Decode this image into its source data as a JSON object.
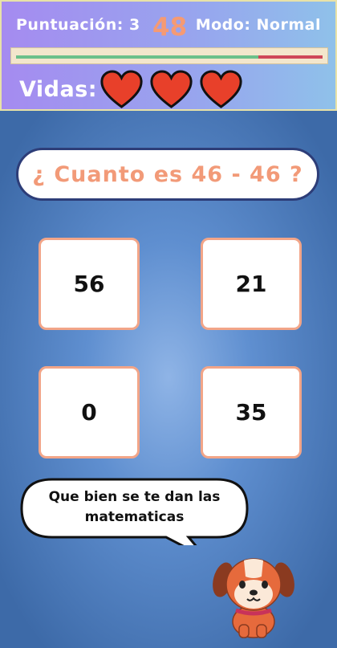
{
  "hud": {
    "score_text": "Puntuación: 3",
    "timer": "48",
    "mode_text": "Modo: Normal",
    "time_remaining_fraction": 0.79,
    "lives_label": "Vidas:",
    "lives": 3
  },
  "question": {
    "text": "¿ Cuanto es 46 - 46 ?"
  },
  "answers": [
    "56",
    "21",
    "0",
    "35"
  ],
  "mascot": {
    "line1": "Que bien se te dan las",
    "line2": "matematicas",
    "icon": "dog-mascot-icon"
  },
  "colors": {
    "accent": "#f29a78",
    "heart": "#e8402a",
    "bar_fill": "#6cc08a",
    "bar_rest": "#cf4658"
  }
}
